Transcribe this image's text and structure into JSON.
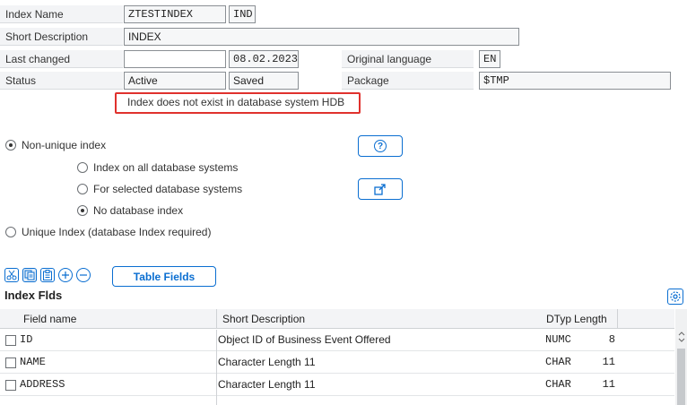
{
  "header": {
    "index_name_label": "Index Name",
    "index_name_table": "ZTESTINDEX",
    "index_name_id": "IND",
    "short_desc_label": "Short Description",
    "short_desc_value": "INDEX",
    "last_changed_label": "Last changed",
    "last_changed_user": "",
    "last_changed_date": "08.02.2023",
    "orig_lang_label": "Original language",
    "orig_lang_value": "EN",
    "status_label": "Status",
    "status_value": "Active",
    "status_saved": "Saved",
    "package_label": "Package",
    "package_value": "$TMP",
    "db_message": "Index does not exist in database system HDB"
  },
  "options": {
    "non_unique": "Non-unique index",
    "all_db": "Index on all database systems",
    "selected_db": "For selected database systems",
    "no_db_index": "No database index",
    "unique": "Unique Index (database Index required)",
    "help_icon_glyph": "?"
  },
  "toolbar": {
    "table_fields_label": "Table Fields"
  },
  "fields_section": {
    "title": "Index Flds",
    "columns": [
      "Field name",
      "Short Description",
      "DTyp",
      "Length"
    ],
    "rows": [
      {
        "field": "ID",
        "desc": "Object ID of Business Event Offered",
        "dtyp": "NUMC",
        "length": "8"
      },
      {
        "field": "NAME",
        "desc": "Character Length 11",
        "dtyp": "CHAR",
        "length": "11"
      },
      {
        "field": "ADDRESS",
        "desc": "Character Length 11",
        "dtyp": "CHAR",
        "length": "11"
      }
    ]
  },
  "colors": {
    "accent": "#0a6ed1",
    "highlight": "#e0312d",
    "label_bg": "#f3f4f6"
  }
}
